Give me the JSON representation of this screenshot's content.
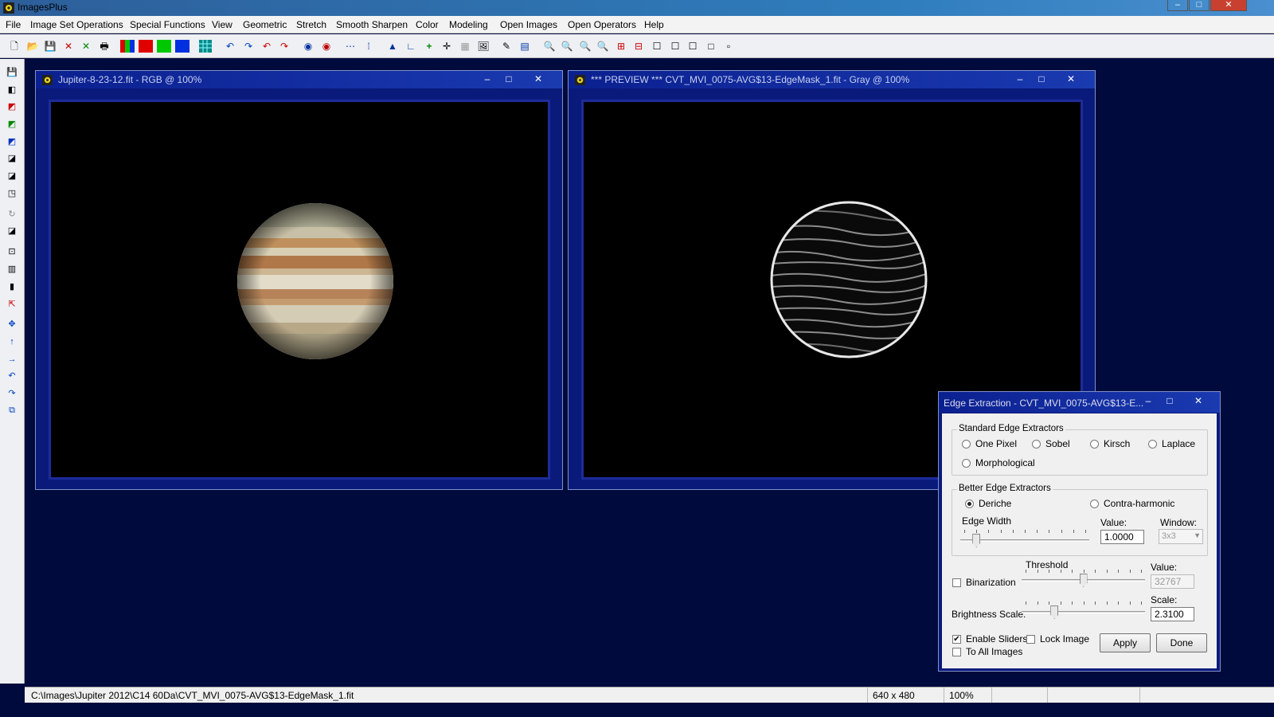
{
  "app": {
    "title": "ImagesPlus",
    "win_min": "–",
    "win_max": "□",
    "win_close": "✕"
  },
  "menu": [
    "File",
    "Image Set Operations",
    "Special Functions",
    "View",
    "Geometric",
    "Stretch",
    "Smooth Sharpen",
    "Color",
    "Modeling",
    "Open Images",
    "Open Operators",
    "Help"
  ],
  "windows": {
    "left": {
      "title": "Jupiter-8-23-12.fit - RGB @ 100%"
    },
    "right": {
      "title": "*** PREVIEW *** CVT_MVI_0075-AVG$13-EdgeMask_1.fit - Gray @ 100%"
    }
  },
  "dialog": {
    "title": "Edge Extraction - CVT_MVI_0075-AVG$13-E...",
    "standard": {
      "label": "Standard Edge Extractors",
      "options": [
        "One Pixel",
        "Sobel",
        "Kirsch",
        "Laplace",
        "Morphological"
      ]
    },
    "better": {
      "label": "Better Edge Extractors",
      "options": [
        "Deriche",
        "Contra-harmonic"
      ],
      "selected": "Deriche",
      "edge_width_label": "Edge Width",
      "value_label": "Value:",
      "value": "1.0000",
      "edge_width_level": 0.1,
      "window_label": "Window:",
      "window_value": "3x3"
    },
    "threshold": {
      "label": "Threshold",
      "binarization_label": "Binarization",
      "value_label": "Value:",
      "value": "32767",
      "level": 0.5
    },
    "brightness": {
      "label": "Brightness Scale:",
      "scale_label": "Scale:",
      "value": "2.3100",
      "level": 0.25
    },
    "enable_sliders_label": "Enable Sliders",
    "lock_image_label": "Lock Image",
    "to_all_images_label": "To All Images",
    "apply_label": "Apply",
    "done_label": "Done"
  },
  "status": {
    "path": "C:\\Images\\Jupiter 2012\\C14 60Da\\CVT_MVI_0075-AVG$13-EdgeMask_1.fit",
    "size": "640 x 480",
    "zoom": "100%"
  },
  "colors": {
    "workspace": "#000a3c",
    "child_frame": "#0a1a7a",
    "red": "#e00000",
    "green": "#00c800",
    "blue": "#0030e0"
  }
}
